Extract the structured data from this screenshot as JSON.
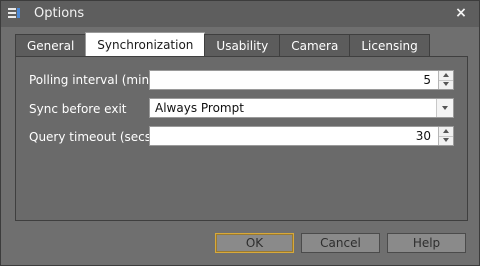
{
  "window": {
    "title": "Options",
    "close_glyph": "×",
    "icon": "options-app-icon"
  },
  "tabs": [
    {
      "label": "General",
      "active": false
    },
    {
      "label": "Synchronization",
      "active": true
    },
    {
      "label": "Usability",
      "active": false
    },
    {
      "label": "Camera",
      "active": false
    },
    {
      "label": "Licensing",
      "active": false
    }
  ],
  "synchronization": {
    "polling_interval": {
      "label": "Polling interval (mins)",
      "value": "5"
    },
    "sync_before_exit": {
      "label": "Sync before exit",
      "value": "Always Prompt"
    },
    "query_timeout": {
      "label": "Query timeout (secs)",
      "value": "30"
    }
  },
  "buttons": {
    "ok": "OK",
    "cancel": "Cancel",
    "help": "Help"
  },
  "colors": {
    "default_button_border": "#d8a93a",
    "app_icon_accent": "#4c8ad8"
  }
}
